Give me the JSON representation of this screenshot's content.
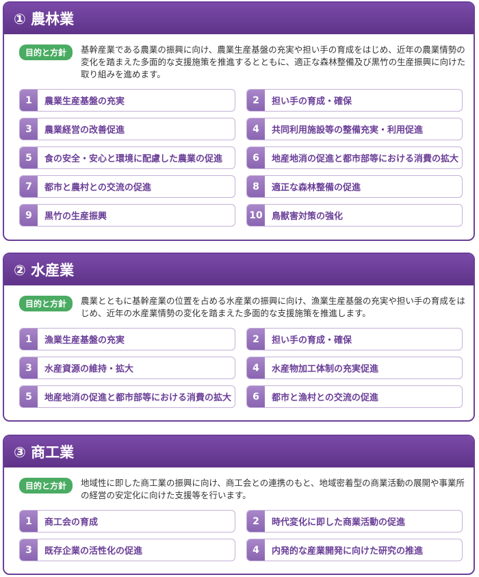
{
  "badge_label": "目的と方針",
  "sections": [
    {
      "title": "① 農林業",
      "purpose": "基幹産業である農業の振興に向け、農業生産基盤の充実や担い手の育成をはじめ、近年の農業情勢の変化を踏まえた多面的な支援施策を推進するとともに、適正な森林整備及び黒竹の生産振興に向けた取り組みを進めます。",
      "items": [
        {
          "num": "1",
          "label": "農業生産基盤の充実"
        },
        {
          "num": "2",
          "label": "担い手の育成・確保"
        },
        {
          "num": "3",
          "label": "農業経営の改善促進"
        },
        {
          "num": "4",
          "label": "共同利用施設等の整備充実・利用促進"
        },
        {
          "num": "5",
          "label": "食の安全・安心と環境に配慮した農業の促進"
        },
        {
          "num": "6",
          "label": "地産地消の促進と都市部等における消費の拡大"
        },
        {
          "num": "7",
          "label": "都市と農村との交流の促進"
        },
        {
          "num": "8",
          "label": "適正な森林整備の促進"
        },
        {
          "num": "9",
          "label": "黒竹の生産振興"
        },
        {
          "num": "10",
          "label": "鳥獣害対策の強化"
        }
      ]
    },
    {
      "title": "② 水産業",
      "purpose": "農業とともに基幹産業の位置を占める水産業の振興に向け、漁業生産基盤の充実や担い手の育成をはじめ、近年の水産業情勢の変化を踏まえた多面的な支援施策を推進します。",
      "items": [
        {
          "num": "1",
          "label": "漁業生産基盤の充実"
        },
        {
          "num": "2",
          "label": "担い手の育成・確保"
        },
        {
          "num": "3",
          "label": "水産資源の維持・拡大"
        },
        {
          "num": "4",
          "label": "水産物加工体制の充実促進"
        },
        {
          "num": "5",
          "label": "地産地消の促進と都市部等における消費の拡大"
        },
        {
          "num": "6",
          "label": "都市と漁村との交流の促進"
        }
      ]
    },
    {
      "title": "③ 商工業",
      "purpose": "地域性に即した商工業の振興に向け、商工会との連携のもと、地域密着型の商業活動の展開や事業所の経営の安定化に向けた支援等を行います。",
      "items": [
        {
          "num": "1",
          "label": "商工会の育成"
        },
        {
          "num": "2",
          "label": "時代変化に即した商業活動の促進"
        },
        {
          "num": "3",
          "label": "既存企業の活性化の促進"
        },
        {
          "num": "4",
          "label": "内発的な産業開発に向けた研究の推進"
        }
      ]
    }
  ]
}
